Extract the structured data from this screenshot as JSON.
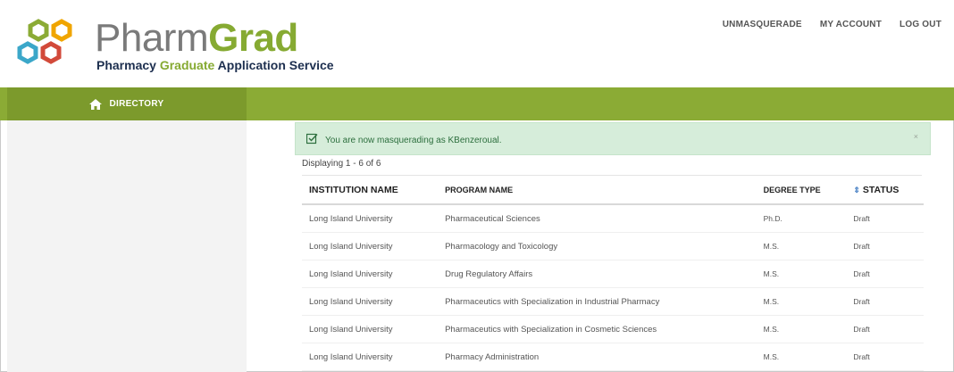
{
  "brand": {
    "name_part1": "Pharm",
    "name_part2": "Grad",
    "tagline_part1": "Pharmacy ",
    "tagline_part2": "Graduate",
    "tagline_part3": " Application Service"
  },
  "topnav": {
    "unmasquerade": "UNMASQUERADE",
    "my_account": "MY ACCOUNT",
    "log_out": "LOG OUT"
  },
  "nav": {
    "directory_label": "DIRECTORY"
  },
  "alert": {
    "message": "You are now masquerading as KBenzeroual.",
    "close": "×"
  },
  "results": {
    "summary": "Displaying 1 - 6 of 6",
    "columns": [
      "INSTITUTION NAME",
      "PROGRAM NAME",
      "DEGREE TYPE",
      "STATUS"
    ],
    "rows": [
      [
        "Long Island University",
        "Pharmaceutical Sciences",
        "Ph.D.",
        "Draft"
      ],
      [
        "Long Island University",
        "Pharmacology and Toxicology",
        "M.S.",
        "Draft"
      ],
      [
        "Long Island University",
        "Drug Regulatory Affairs",
        "M.S.",
        "Draft"
      ],
      [
        "Long Island University",
        "Pharmaceutics with Specialization in Industrial Pharmacy",
        "M.S.",
        "Draft"
      ],
      [
        "Long Island University",
        "Pharmaceutics with Specialization in Cosmetic Sciences",
        "M.S.",
        "Draft"
      ],
      [
        "Long Island University",
        "Pharmacy Administration",
        "M.S.",
        "Draft"
      ]
    ]
  },
  "colors": {
    "brand_green": "#86aa32",
    "nav_green": "#8bab35",
    "alert_bg": "#d6edda"
  },
  "icons": {
    "home": "home-icon",
    "check": "checkbox-check-icon",
    "sort": "sort-icon",
    "logo": "hexagon-logo-icon"
  }
}
